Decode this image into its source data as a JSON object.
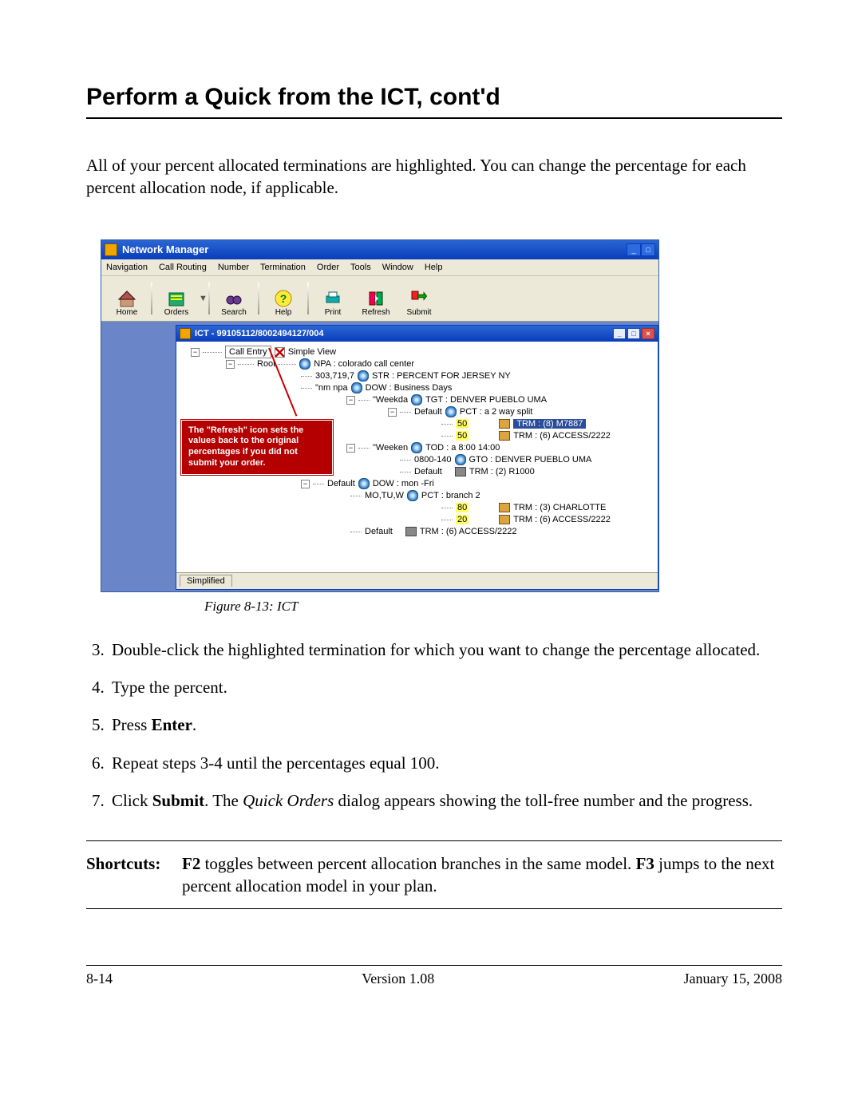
{
  "page_title": "Perform a Quick from the ICT, cont'd",
  "intro": "All of your percent allocated terminations are highlighted. You can change the percentage for each percent allocation node, if applicable.",
  "window": {
    "title": "Network Manager",
    "menus": [
      "Navigation",
      "Call Routing",
      "Number",
      "Termination",
      "Order",
      "Tools",
      "Window",
      "Help"
    ],
    "toolbar": [
      "Home",
      "Orders",
      "Search",
      "Help",
      "Print",
      "Refresh",
      "Submit"
    ],
    "inner_title": "ICT - 99105112/8002494127/004",
    "call_entry_label": "Call Entry",
    "simple_view_label": "Simple View",
    "root_label": "Root",
    "tree": {
      "npa": "NPA : colorado call center",
      "str": "303,719,7",
      "str_lbl": "STR : PERCENT FOR JERSEY NY",
      "nm": "\"nm npa",
      "dow_biz": "DOW : Business Days",
      "weekda": "\"Weekda",
      "tgt1": "TGT : DENVER PUEBLO UMA",
      "default": "Default",
      "pct1": "PCT : a 2 way split",
      "pct1_a": "50",
      "pct1_a_lbl": "TRM : (8) M7887",
      "pct1_b": "50",
      "pct1_b_lbl": "TRM : (6) ACCESS/2222",
      "weeken": "\"Weeken",
      "tod": "TOD : a 8:00 14:00",
      "range": "0800-140",
      "gto": "GTO : DENVER PUEBLO UMA",
      "trm_r1000": "TRM : (2) R1000",
      "dow_mf": "DOW : mon -Fri",
      "motuw": "MO,TU,W",
      "pct2": "PCT : branch 2",
      "pct2_a": "80",
      "pct2_a_lbl": "TRM : (3) CHARLOTTE",
      "pct2_b": "20",
      "pct2_b_lbl": "TRM : (6) ACCESS/2222",
      "trm_last": "TRM : (6) ACCESS/2222"
    },
    "callout": "The \"Refresh\" icon sets the values back to the original percentages if you did not submit your order.",
    "status_tab": "Simplified"
  },
  "caption": "Figure 8-13:   ICT",
  "steps": {
    "s3": "Double-click the highlighted termination for which you want to change the percentage allocated.",
    "s4": "Type the percent.",
    "s5_a": "Press ",
    "s5_b": "Enter",
    "s5_c": ".",
    "s6": "Repeat steps 3-4 until the percentages equal 100.",
    "s7_a": "Click ",
    "s7_b": "Submit",
    "s7_c": ". The ",
    "s7_d": "Quick Orders",
    "s7_e": " dialog appears showing the toll-free number and the progress."
  },
  "shortcuts": {
    "label": "Shortcuts:",
    "t1": "F2",
    "t2": " toggles between percent allocation branches in the same model. ",
    "t3": "F3",
    "t4": " jumps to the next percent allocation model in your plan."
  },
  "footer": {
    "left": "8-14",
    "center": "Version 1.08",
    "right": "January 15, 2008"
  }
}
